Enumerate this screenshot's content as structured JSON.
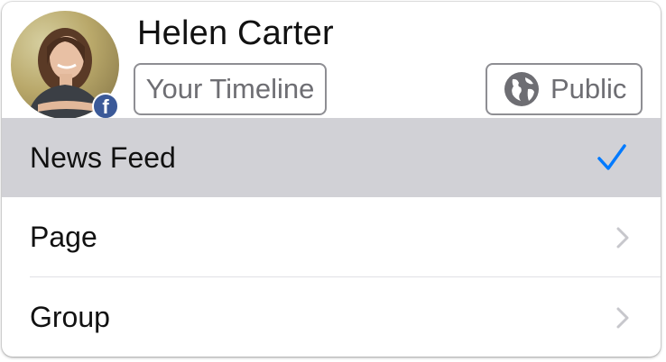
{
  "profile": {
    "name": "Helen Carter",
    "timeline_button": "Your Timeline",
    "audience_button": "Public",
    "badge_letter": "f"
  },
  "menu": {
    "items": [
      {
        "label": "News Feed",
        "selected": true,
        "accessory": "checkmark-icon"
      },
      {
        "label": "Page",
        "selected": false,
        "accessory": "chevron-right-icon"
      },
      {
        "label": "Group",
        "selected": false,
        "accessory": "chevron-right-icon"
      }
    ]
  },
  "colors": {
    "selected_row": "#d1d1d6",
    "checkmark": "#007aff",
    "chevron": "#c7c7cc",
    "pill_border": "#8e8e93",
    "facebook_blue": "#3b5998"
  }
}
